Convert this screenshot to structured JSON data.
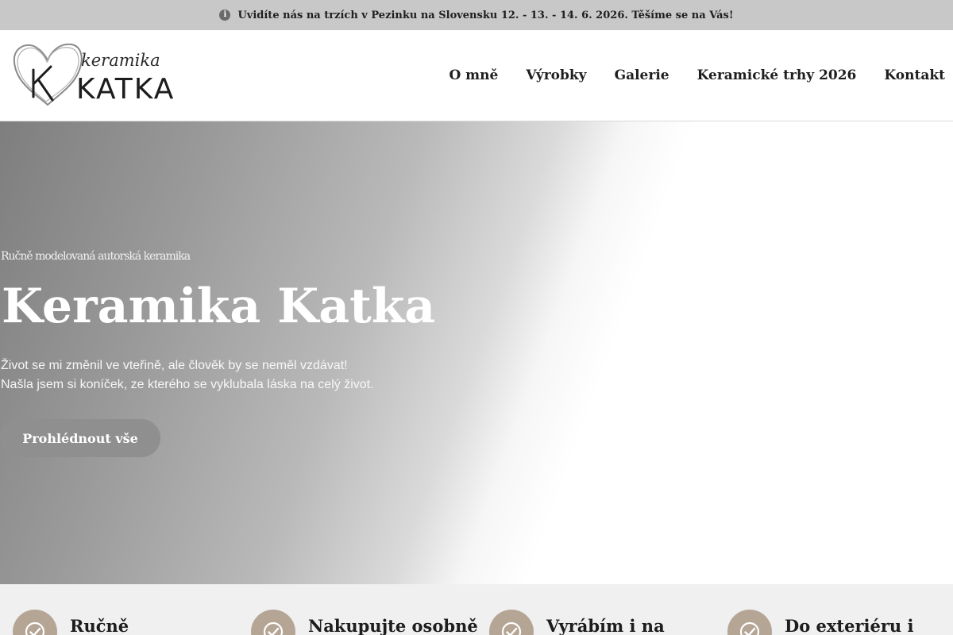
{
  "announcement": {
    "icon": "info-icon",
    "text": "Uvidíte nás na trzích v Pezinku na Slovensku 12. - 13. - 14. 6. 2026. Těšíme se na Vás!"
  },
  "logo": {
    "script": "keramika",
    "wordmark": "KATKA"
  },
  "nav": {
    "items": [
      "O mně",
      "Výrobky",
      "Galerie",
      "Keramické trhy 2026",
      "Kontakt"
    ]
  },
  "hero": {
    "eyebrow": "Ručně modelovaná autorská keramika",
    "title": "Keramika Katka",
    "lead": "Život se mi změnil ve vteřině, ale člověk by se neměl vzdávat! Našla jsem si koníček, ze kterého se vyklubala láska na celý život.",
    "cta": "Prohlédnout vše"
  },
  "features": [
    {
      "icon": "check-circle-icon",
      "title": "Ručně"
    },
    {
      "icon": "check-circle-icon",
      "title": "Nakupujte osobně"
    },
    {
      "icon": "check-circle-icon",
      "title": "Vyrábím i na"
    },
    {
      "icon": "check-circle-icon",
      "title": "Do exteriéru i"
    }
  ],
  "colors": {
    "announcement_bg": "#c8c8c8",
    "feature_badge": "#b5a595",
    "features_bg": "#f0f0f0",
    "cta_bg": "#8f8f8f"
  }
}
